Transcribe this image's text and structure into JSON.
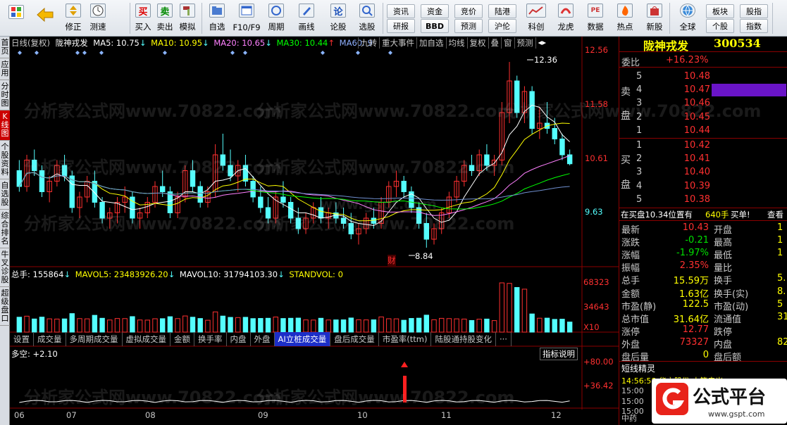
{
  "toolbar": {
    "items": [
      "",
      "",
      "修正",
      "测速",
      "买入",
      "卖出",
      "模拟",
      "自选",
      "F10/F9",
      "周期",
      "画线",
      "论股",
      "选股"
    ],
    "small_buttons": [
      "资讯",
      "资金",
      "竞价",
      "陆港",
      "研报",
      "BBD",
      "预测",
      "沪伦"
    ],
    "right_items": [
      "科创",
      "龙虎",
      "数据",
      "热点",
      "新股",
      "全球"
    ],
    "mini_buttons": [
      "板块",
      "股指",
      "个股",
      "指数"
    ],
    "icon_chars": {
      "buy": "买",
      "sell": "卖",
      "lun": "论"
    }
  },
  "leftbar": {
    "tabs": [
      "首页",
      "应用",
      "分时图",
      "K线图",
      "个股资料",
      "自选股",
      "综合排名",
      "牛叉诊股",
      "超级盘口"
    ]
  },
  "chart_header": {
    "period": "日线(复权)",
    "stock": "陇神戎发",
    "ma5": "MA5: 10.75",
    "ma10": "MA10: 10.95",
    "ma20": "MA20: 10.65",
    "ma30": "MA30: 10.44",
    "ma60": "MA60: 9",
    "menu": [
      "九转",
      "重大事件",
      "加自选",
      "均线",
      "复权",
      "叠",
      "窗",
      "预测",
      "◂▸"
    ]
  },
  "price_axis": [
    "12.56",
    "11.58",
    "10.61",
    "9.63"
  ],
  "annot": {
    "high": "12.36",
    "low": "8.84",
    "cai": "财"
  },
  "volume_header": {
    "total": "总手: 155864",
    "mavol5": "MAVOL5: 23483926.20",
    "mavol10": "MAVOL10: 31794103.30",
    "stand": "STANDVOL: 0"
  },
  "volume_axis": [
    "68323",
    "34643",
    "X10"
  ],
  "indicator_tabs": [
    "设置",
    "成交量",
    "多周期成交量",
    "虚拟成交量",
    "金额",
    "换手率",
    "内盘",
    "外盘",
    "AI立桩成交量",
    "盘后成交量",
    "市盈率(ttm)",
    "陆股通持股变化",
    "···"
  ],
  "indicator": {
    "label": "多空: +2.10",
    "help": "指标说明",
    "axis": [
      "+80.00",
      "+36.42"
    ]
  },
  "x_axis": [
    "06",
    "07",
    "08",
    "09",
    "10",
    "11",
    "12"
  ],
  "quote": {
    "name": "陇神戎发",
    "code": "300534",
    "weibi_label": "委比",
    "weibi": "+16.23%",
    "sell_label": [
      "卖",
      "盘"
    ],
    "buy_label": [
      "买",
      "盘"
    ],
    "asks": [
      {
        "level": "5",
        "price": "10.48"
      },
      {
        "level": "4",
        "price": "10.47"
      },
      {
        "level": "3",
        "price": "10.46"
      },
      {
        "level": "2",
        "price": "10.45"
      },
      {
        "level": "1",
        "price": "10.44"
      }
    ],
    "bids": [
      {
        "level": "1",
        "price": "10.42"
      },
      {
        "level": "2",
        "price": "10.41"
      },
      {
        "level": "3",
        "price": "10.40"
      },
      {
        "level": "4",
        "price": "10.39"
      },
      {
        "level": "5",
        "price": "10.38"
      }
    ],
    "buy_line": {
      "text": "在买盘10.34位置有",
      "vol": "640手",
      "action": "买单!",
      "link": "查看"
    },
    "stats": [
      {
        "l": "最新",
        "v": "10.43",
        "r": "开盘",
        "rv": "1"
      },
      {
        "l": "涨跌",
        "v": "-0.21",
        "r": "最高",
        "rv": "1"
      },
      {
        "l": "涨幅",
        "v": "-1.97%",
        "r": "最低",
        "rv": "1"
      },
      {
        "l": "振幅",
        "v": "2.35%",
        "r": "量比",
        "rv": ""
      },
      {
        "l": "总手",
        "v": "15.59万",
        "r": "换手",
        "rv": "5."
      },
      {
        "l": "金额",
        "v": "1.63亿",
        "r": "换手(实)",
        "rv": "8."
      },
      {
        "l": "市盈(静)",
        "v": "122.5",
        "r": "市盈(动)",
        "rv": "5"
      },
      {
        "l": "总市值",
        "v": "31.64亿",
        "r": "流通值",
        "rv": "31.3"
      },
      {
        "l": "涨停",
        "v": "12.77",
        "r": "跌停",
        "rv": ""
      },
      {
        "l": "外盘",
        "v": "73327",
        "r": "内盘",
        "rv": "82"
      },
      {
        "l": "盘后量",
        "v": "0",
        "r": "盘后额",
        "rv": ""
      }
    ],
    "short": "短线精灵",
    "short_rows": [
      "14:56:58  华立股份  大笔卖出",
      "15:00",
      "15:00",
      "15:00",
      "中药"
    ]
  },
  "logo": {
    "text": "公式平台",
    "url": "www.gspt.com"
  },
  "watermark": [
    "分析家公式网www.70822.com",
    "www.gspt.com"
  ],
  "colors": {
    "up": "#ff3030",
    "down": "#54ffff",
    "ma5": "#ffffff",
    "ma10": "#ffff00",
    "ma20": "#ff80ff",
    "ma30": "#00ff00",
    "ma60": "#6f8fcf"
  },
  "chart_data": {
    "type": "candlestick",
    "xlabel": "",
    "ylabel": "",
    "ylim": [
      8.6,
      12.6
    ],
    "x_ticks": [
      "06",
      "07",
      "08",
      "09",
      "10",
      "11",
      "12"
    ],
    "ohlc": [
      [
        10.3,
        10.5,
        9.9,
        10.0
      ],
      [
        10.0,
        10.6,
        9.9,
        10.5
      ],
      [
        10.5,
        10.7,
        10.2,
        10.3
      ],
      [
        10.3,
        10.4,
        9.8,
        9.9
      ],
      [
        9.9,
        10.2,
        9.7,
        10.1
      ],
      [
        10.1,
        10.5,
        10.0,
        10.4
      ],
      [
        10.4,
        10.6,
        10.1,
        10.2
      ],
      [
        10.2,
        10.3,
        9.5,
        9.6
      ],
      [
        9.6,
        9.9,
        9.4,
        9.8
      ],
      [
        9.8,
        10.2,
        9.7,
        10.1
      ],
      [
        10.1,
        10.3,
        9.6,
        9.7
      ],
      [
        9.7,
        9.8,
        9.3,
        9.4
      ],
      [
        9.4,
        9.6,
        9.2,
        9.5
      ],
      [
        9.5,
        9.8,
        9.3,
        9.7
      ],
      [
        9.7,
        10.0,
        9.5,
        9.8
      ],
      [
        9.8,
        9.9,
        9.3,
        9.4
      ],
      [
        9.4,
        9.6,
        9.2,
        9.5
      ],
      [
        9.5,
        9.8,
        9.4,
        9.7
      ],
      [
        9.7,
        10.1,
        9.6,
        10.0
      ],
      [
        10.0,
        10.3,
        9.8,
        9.9
      ],
      [
        9.9,
        10.0,
        9.4,
        9.5
      ],
      [
        9.5,
        9.9,
        9.4,
        9.8
      ],
      [
        9.8,
        10.4,
        9.7,
        10.3
      ],
      [
        10.3,
        10.5,
        9.9,
        10.0
      ],
      [
        10.0,
        10.1,
        9.6,
        9.7
      ],
      [
        9.7,
        10.0,
        9.6,
        9.9
      ],
      [
        9.9,
        10.8,
        9.8,
        10.6
      ],
      [
        10.6,
        11.0,
        10.3,
        10.4
      ],
      [
        10.4,
        10.7,
        10.1,
        10.2
      ],
      [
        10.2,
        10.5,
        9.9,
        10.4
      ],
      [
        10.4,
        10.6,
        10.0,
        10.1
      ],
      [
        10.1,
        10.2,
        9.7,
        9.8
      ],
      [
        9.8,
        10.0,
        9.5,
        9.6
      ],
      [
        9.6,
        9.8,
        9.3,
        9.4
      ],
      [
        9.4,
        9.9,
        9.3,
        9.8
      ],
      [
        9.8,
        10.1,
        9.6,
        9.7
      ],
      [
        9.7,
        9.8,
        9.3,
        9.4
      ],
      [
        9.4,
        9.6,
        9.1,
        9.2
      ],
      [
        9.2,
        9.5,
        9.1,
        9.4
      ],
      [
        9.4,
        9.7,
        9.3,
        9.6
      ],
      [
        9.6,
        9.8,
        9.3,
        9.4
      ],
      [
        9.4,
        9.6,
        9.2,
        9.5
      ],
      [
        9.5,
        9.7,
        9.3,
        9.4
      ],
      [
        9.4,
        9.6,
        9.2,
        9.3
      ],
      [
        9.3,
        9.5,
        9.0,
        9.1
      ],
      [
        9.1,
        9.3,
        8.9,
        9.2
      ],
      [
        9.2,
        9.5,
        9.1,
        9.4
      ],
      [
        9.4,
        9.6,
        9.2,
        9.3
      ],
      [
        9.3,
        9.8,
        9.2,
        9.7
      ],
      [
        9.7,
        10.1,
        9.6,
        10.0
      ],
      [
        10.0,
        10.3,
        9.8,
        10.1
      ],
      [
        10.1,
        10.2,
        9.8,
        9.9
      ],
      [
        9.9,
        10.0,
        9.5,
        9.6
      ],
      [
        9.6,
        9.7,
        9.2,
        9.3
      ],
      [
        9.3,
        9.5,
        8.84,
        9.0
      ],
      [
        9.0,
        9.3,
        8.9,
        9.2
      ],
      [
        9.2,
        9.6,
        9.1,
        9.5
      ],
      [
        9.5,
        9.9,
        9.4,
        9.8
      ],
      [
        9.8,
        10.2,
        9.7,
        10.1
      ],
      [
        10.1,
        10.5,
        10.0,
        10.4
      ],
      [
        10.4,
        10.6,
        10.2,
        10.3
      ],
      [
        10.3,
        10.7,
        10.2,
        10.6
      ],
      [
        10.6,
        10.8,
        10.3,
        10.4
      ],
      [
        10.4,
        10.6,
        10.2,
        10.5
      ],
      [
        10.5,
        11.6,
        10.4,
        11.4
      ],
      [
        11.4,
        12.36,
        11.2,
        12.0
      ],
      [
        12.0,
        12.1,
        11.3,
        11.4
      ],
      [
        11.4,
        11.9,
        11.2,
        11.8
      ],
      [
        11.8,
        11.9,
        11.0,
        11.1
      ],
      [
        11.1,
        11.5,
        10.9,
        11.2
      ],
      [
        11.2,
        11.6,
        11.0,
        11.1
      ],
      [
        11.1,
        11.3,
        10.8,
        10.9
      ],
      [
        10.9,
        11.0,
        10.5,
        10.6
      ],
      [
        10.6,
        10.7,
        10.4,
        10.43
      ]
    ],
    "ma_series": [
      {
        "name": "MA5",
        "values": []
      },
      {
        "name": "MA10",
        "values": []
      },
      {
        "name": "MA20",
        "values": []
      },
      {
        "name": "MA30",
        "values": []
      },
      {
        "name": "MA60",
        "values": []
      }
    ]
  }
}
